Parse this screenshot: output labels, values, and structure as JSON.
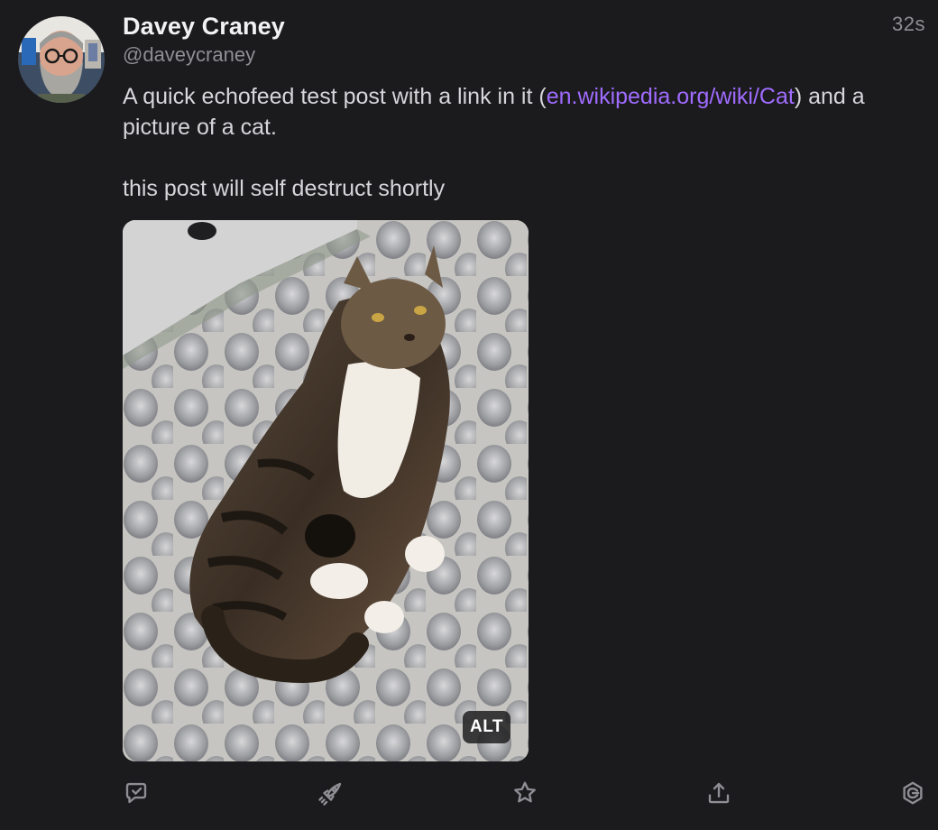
{
  "post": {
    "author": {
      "display_name": "Davey Craney",
      "handle": "@daveycraney",
      "avatar_icon": "user-avatar"
    },
    "timestamp": "32s",
    "text": {
      "line1_before": "A quick echofeed test post with a link in it (",
      "link_text": "en.wikipedia.org/wiki/Cat",
      "line1_after": ") and a picture of a cat.",
      "line2": "this post will self destruct shortly"
    },
    "media": {
      "alt_badge": "ALT"
    },
    "actions": [
      {
        "name": "reply",
        "icon": "reply-icon"
      },
      {
        "name": "boost",
        "icon": "rocket-icon"
      },
      {
        "name": "favourite",
        "icon": "star-icon"
      },
      {
        "name": "share",
        "icon": "share-icon"
      },
      {
        "name": "more",
        "icon": "settings-icon"
      }
    ]
  },
  "colors": {
    "background": "#1b1b1d",
    "link": "#a06bff",
    "muted": "#8e8e94",
    "text": "#d6d6da"
  }
}
